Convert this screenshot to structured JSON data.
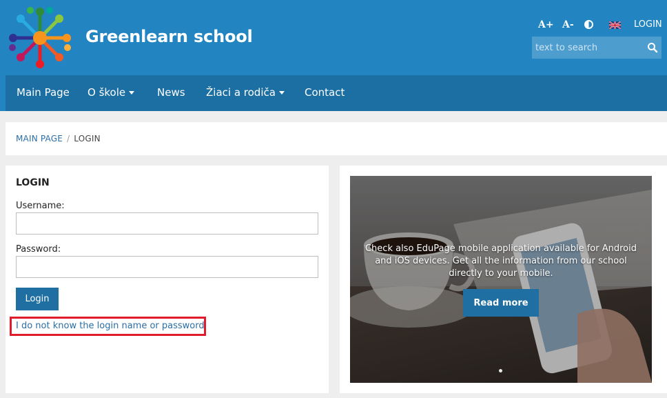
{
  "header": {
    "site_title": "Greenlearn school",
    "tools": {
      "font_increase": "A+",
      "font_decrease": "A-",
      "login": "LOGIN"
    },
    "search": {
      "placeholder": "text to search"
    },
    "icons": [
      "logo",
      "contrast-icon",
      "uk-flag-icon",
      "search-icon"
    ]
  },
  "nav": {
    "items": [
      {
        "label": "Main Page"
      },
      {
        "label": "O škole",
        "has_dropdown": true
      },
      {
        "label": "News"
      },
      {
        "label": "Žiaci a rodiča",
        "has_dropdown": true
      },
      {
        "label": "Contact"
      }
    ]
  },
  "breadcrumb": {
    "items": [
      "MAIN PAGE",
      "LOGIN"
    ],
    "separator": "/"
  },
  "login": {
    "title": "LOGIN",
    "username_label": "Username:",
    "username_value": "",
    "password_label": "Password:",
    "password_value": "",
    "submit_label": "Login",
    "forgot_link": "I do not know the login name or password"
  },
  "promo": {
    "text": "Check also EduPage mobile application available for Android and iOS devices. Get all the information from our school directly to your mobile.",
    "button_label": "Read more"
  },
  "colors": {
    "header_bg": "#2285c2",
    "nav_bg": "#1c6fa3",
    "button_bg": "#1f6fa3",
    "link": "#2a6ea7",
    "highlight": "#e01b2b"
  }
}
